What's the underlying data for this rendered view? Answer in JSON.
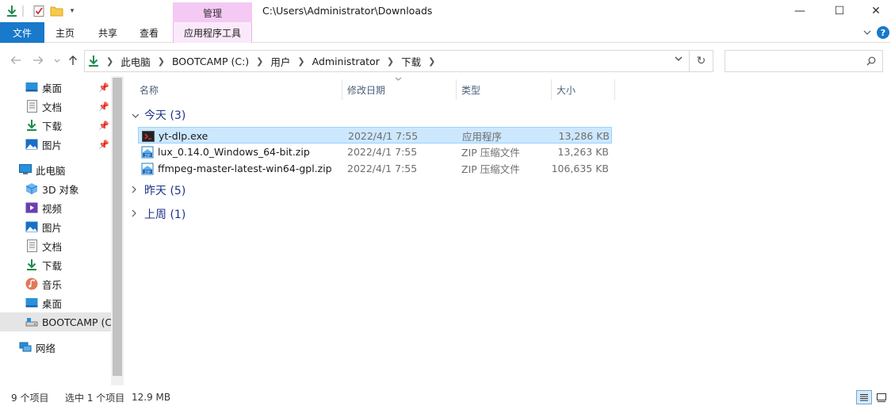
{
  "window": {
    "title": "C:\\Users\\Administrator\\Downloads",
    "context_tab_title": "管理",
    "controls": {
      "minimize": "—",
      "maximize": "☐",
      "close": "✕"
    }
  },
  "ribbon": {
    "tabs": [
      {
        "label": "文件"
      },
      {
        "label": "主页"
      },
      {
        "label": "共享"
      },
      {
        "label": "查看"
      },
      {
        "label": "应用程序工具"
      }
    ],
    "expand_icon": "chevron-down-icon",
    "help_icon": "?"
  },
  "address": {
    "crumbs": [
      "此电脑",
      "BOOTCAMP (C:)",
      "用户",
      "Administrator",
      "下载"
    ],
    "dropdown_glyph": "⌄",
    "refresh_glyph": "↻",
    "search_placeholder": ""
  },
  "nav": {
    "quick_access": [
      {
        "label": "桌面",
        "icon": "desktop-icon",
        "pinned": true
      },
      {
        "label": "文档",
        "icon": "document-icon",
        "pinned": true
      },
      {
        "label": "下载",
        "icon": "download-icon",
        "pinned": true
      },
      {
        "label": "图片",
        "icon": "pictures-icon",
        "pinned": true
      }
    ],
    "this_pc": {
      "label": "此电脑",
      "icon": "computer-icon"
    },
    "pc_items": [
      {
        "label": "3D 对象",
        "icon": "3d-objects-icon"
      },
      {
        "label": "视频",
        "icon": "videos-icon"
      },
      {
        "label": "图片",
        "icon": "pictures-icon"
      },
      {
        "label": "文档",
        "icon": "document-icon"
      },
      {
        "label": "下载",
        "icon": "download-icon"
      },
      {
        "label": "音乐",
        "icon": "music-icon"
      },
      {
        "label": "桌面",
        "icon": "desktop-icon"
      },
      {
        "label": "BOOTCAMP (C",
        "icon": "drive-icon"
      }
    ],
    "network": {
      "label": "网络",
      "icon": "network-icon"
    }
  },
  "columns": [
    "名称",
    "修改日期",
    "类型",
    "大小"
  ],
  "groups": [
    {
      "label": "今天 (3)",
      "expanded": true,
      "files": [
        {
          "name": "yt-dlp.exe",
          "date": "2022/4/1 7:55",
          "type": "应用程序",
          "size": "13,286 KB",
          "icon": "exe-icon",
          "selected": true
        },
        {
          "name": "lux_0.14.0_Windows_64-bit.zip",
          "date": "2022/4/1 7:55",
          "type": "ZIP 压缩文件",
          "size": "13,263 KB",
          "icon": "zip-icon",
          "selected": false
        },
        {
          "name": "ffmpeg-master-latest-win64-gpl.zip",
          "date": "2022/4/1 7:55",
          "type": "ZIP 压缩文件",
          "size": "106,635 KB",
          "icon": "zip-icon",
          "selected": false
        }
      ]
    },
    {
      "label": "昨天 (5)",
      "expanded": false
    },
    {
      "label": "上周 (1)",
      "expanded": false
    }
  ],
  "status": {
    "item_count": "9 个项目",
    "selection": "选中 1 个项目",
    "size": "12.9 MB"
  },
  "colors": {
    "file_tab": "#1979ca",
    "context_tab": "#f4c9f4",
    "selection": "#cce8ff",
    "group_text": "#1e3287"
  }
}
